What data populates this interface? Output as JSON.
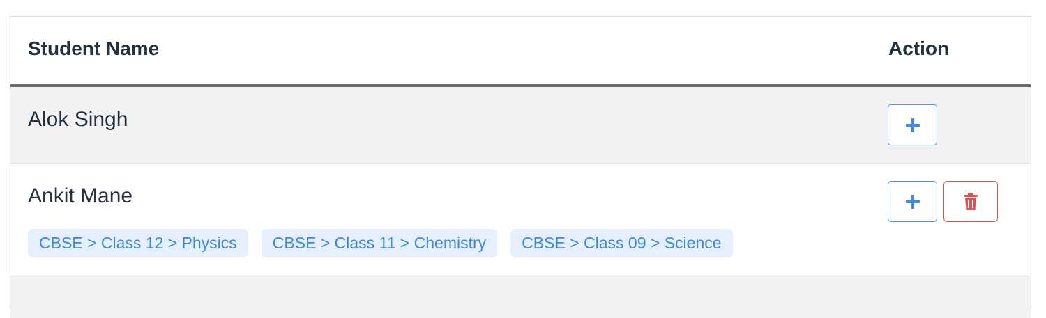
{
  "table": {
    "headers": {
      "name": "Student Name",
      "action": "Action"
    },
    "rows": [
      {
        "name": "Alok Singh",
        "tags": [],
        "actions": [
          "add"
        ]
      },
      {
        "name": "Ankit Mane",
        "tags": [
          "CBSE > Class 12 > Physics",
          "CBSE > Class 11 > Chemistry",
          "CBSE > Class 09 > Science"
        ],
        "actions": [
          "add",
          "delete"
        ]
      }
    ]
  },
  "icons": {
    "add": "plus-icon",
    "delete": "trash-icon"
  },
  "colors": {
    "accent": "#3f88e4",
    "tag_bg": "#e6f0fd",
    "danger": "#d9534f",
    "stripe": "#f2f2f2",
    "header_rule": "#6b6f73"
  }
}
